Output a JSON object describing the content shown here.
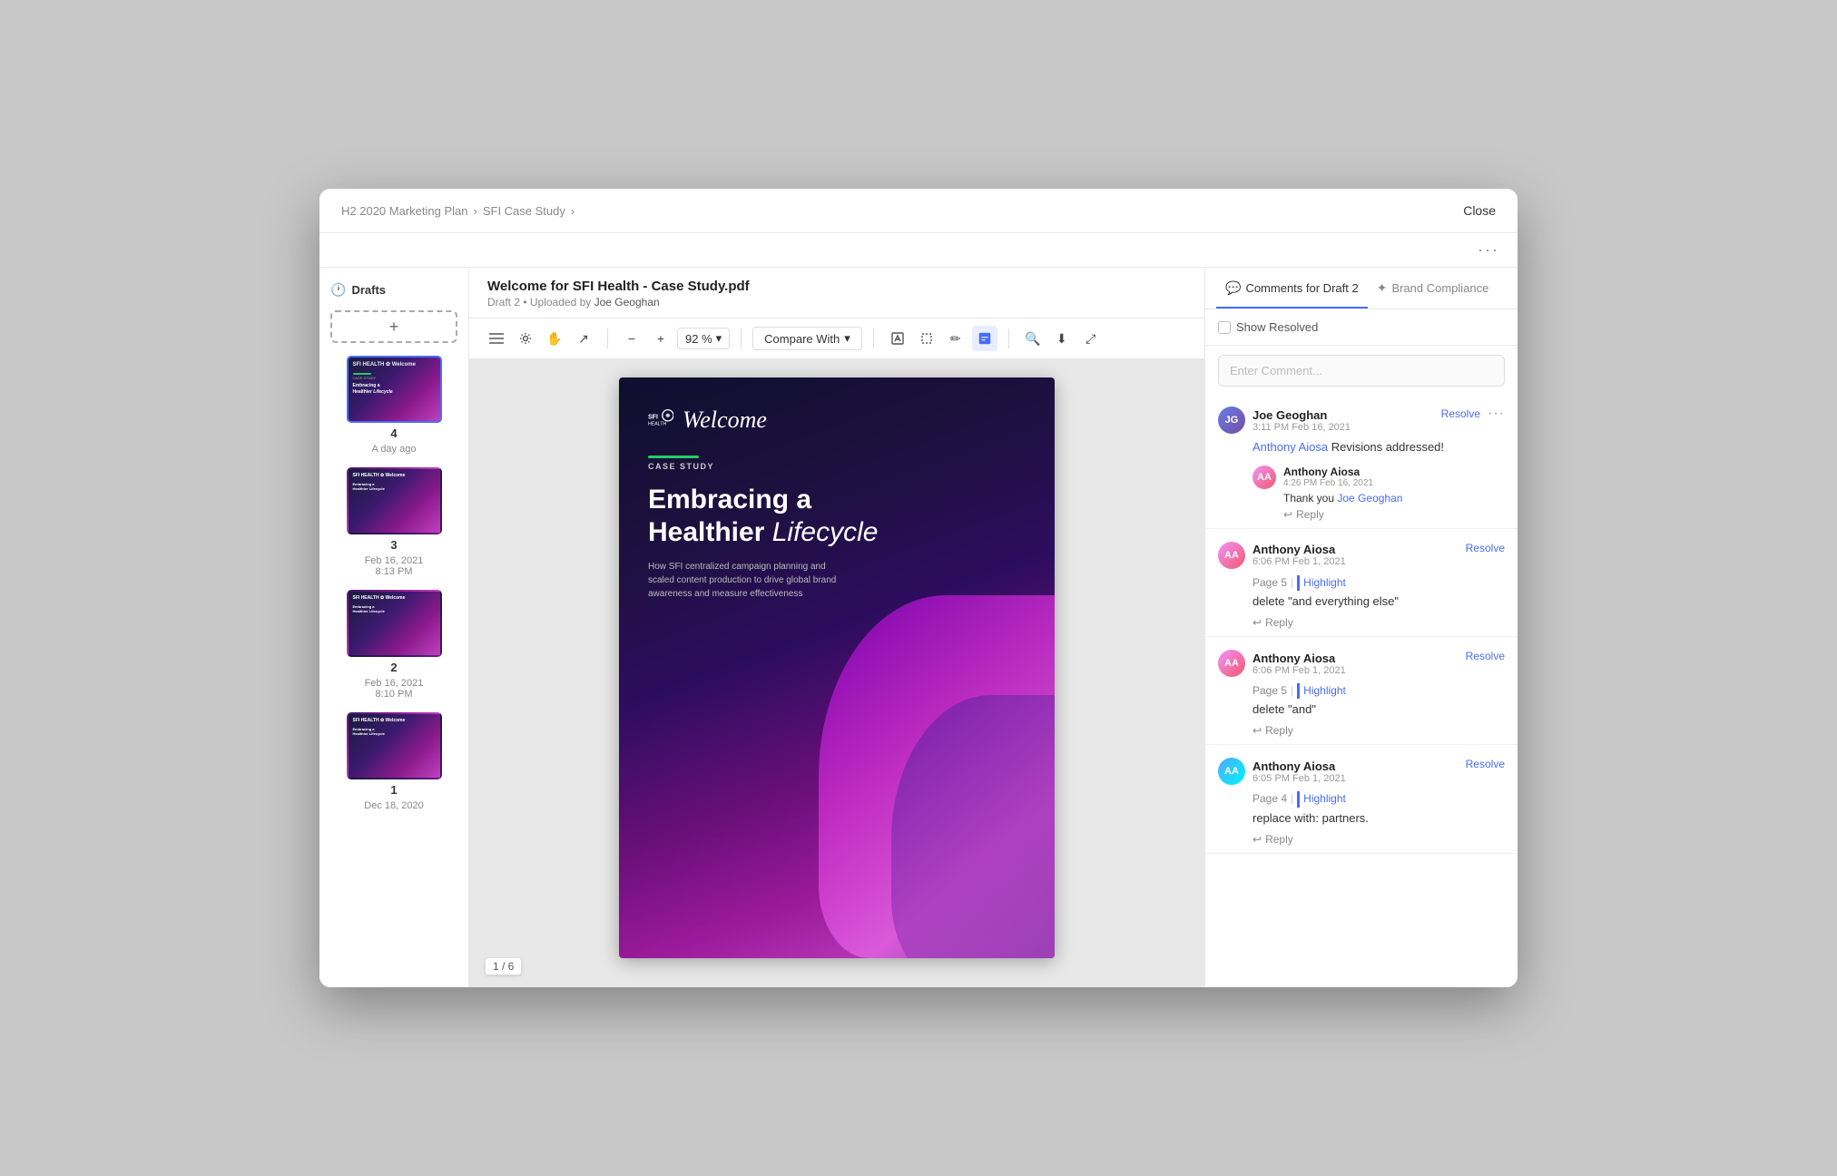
{
  "window": {
    "close_label": "Close",
    "three_dots": "···"
  },
  "breadcrumb": {
    "items": [
      "H2 2020 Marketing Plan",
      "SFI Case Study"
    ]
  },
  "document": {
    "title": "Welcome for SFI Health - Case Study.pdf",
    "subtitle": "Draft 2 • Uploaded by",
    "uploader": "Joe Geoghan",
    "current_page": "1 / 6",
    "zoom": "92 %"
  },
  "toolbar": {
    "compare_label": "Compare With",
    "tools": [
      "sidebar-icon",
      "settings-icon",
      "pan-icon",
      "select-icon",
      "zoom-out-icon",
      "zoom-in-icon",
      "text-icon",
      "crop-icon",
      "draw-icon",
      "annotate-icon",
      "search-icon",
      "download-icon",
      "expand-icon"
    ]
  },
  "pdf": {
    "logo_line1": "SFI",
    "logo_line2": "HEALTH",
    "welcome": "Welcome",
    "section": "CASE STUDY",
    "title_line1": "Embracing a",
    "title_line2": "Healthier Lifecycle",
    "subtitle": "How SFI centralized campaign planning and scaled content production to drive global brand awareness and measure effectiveness"
  },
  "drafts": {
    "header": "Drafts",
    "add_label": "+",
    "items": [
      {
        "num": "4",
        "date": "A day ago"
      },
      {
        "num": "3",
        "date": "Feb 16, 2021\n8:13 PM"
      },
      {
        "num": "2",
        "date": "Feb 16, 2021\n8:10 PM"
      },
      {
        "num": "1",
        "date": "Dec 18, 2020"
      }
    ]
  },
  "right_panel": {
    "tabs": [
      {
        "label": "Comments for Draft 2",
        "active": true,
        "icon": "💬"
      },
      {
        "label": "Brand Compliance",
        "active": false,
        "icon": "✦"
      }
    ],
    "show_resolved_label": "Show Resolved",
    "comment_placeholder": "Enter Comment...",
    "comments": [
      {
        "author": "Joe Geoghan",
        "time": "3:11 PM Feb 16, 2021",
        "initials": "JG",
        "avatar_class": "joe",
        "body": "Anthony Aiosa Revisions addressed!",
        "mention": "Anthony Aiosa",
        "has_resolve": true,
        "has_more": true,
        "replies": [
          {
            "author": "Anthony Aiosa",
            "time": "4:26 PM Feb 16, 2021",
            "initials": "AA",
            "avatar_class": "anthony",
            "text": "Thank you Joe Geoghan",
            "mention": "Joe Geoghan"
          }
        ],
        "reply_label": "Reply"
      },
      {
        "author": "Anthony Aiosa",
        "time": "6:06 PM Feb 1, 2021",
        "initials": "AA",
        "avatar_class": "anthony",
        "page_tag": "Page 5",
        "highlight_tag": "Highlight",
        "body": "delete \"and everything else\"",
        "has_resolve": true,
        "has_more": false,
        "replies": [],
        "reply_label": "Reply"
      },
      {
        "author": "Anthony Aiosa",
        "time": "6:06 PM Feb 1, 2021",
        "initials": "AA",
        "avatar_class": "anthony",
        "page_tag": "Page 5",
        "highlight_tag": "Highlight",
        "body": "delete \"and\"",
        "has_resolve": true,
        "has_more": false,
        "replies": [],
        "reply_label": "Reply"
      },
      {
        "author": "Anthony Aiosa",
        "time": "6:05 PM Feb 1, 2021",
        "initials": "AA",
        "avatar_class": "anthony2",
        "page_tag": "Page 4",
        "highlight_tag": "Highlight",
        "body": "replace with: partners.",
        "has_resolve": true,
        "has_more": false,
        "replies": [],
        "reply_label": "Reply"
      }
    ]
  }
}
